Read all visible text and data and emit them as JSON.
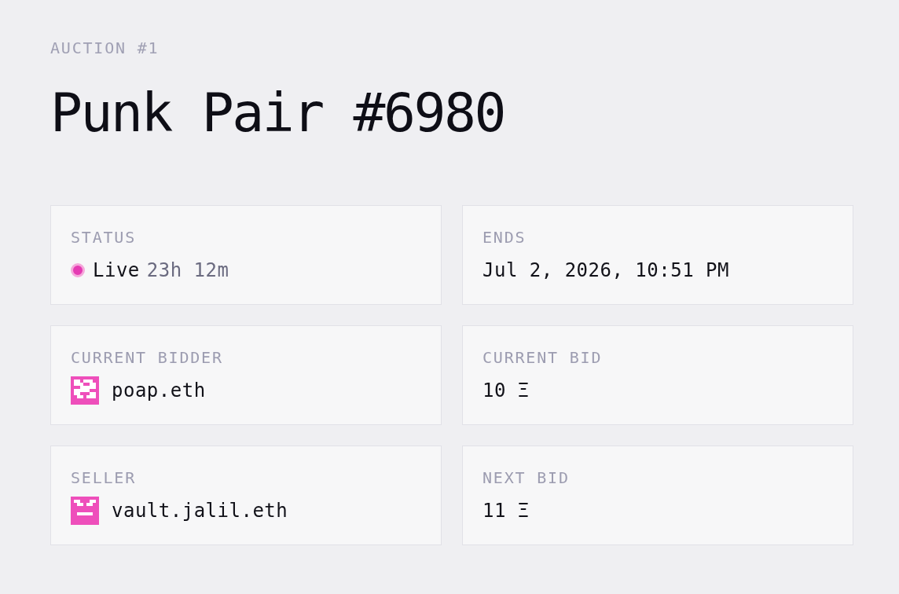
{
  "header": {
    "eyebrow": "AUCTION #1",
    "title": "Punk Pair #6980"
  },
  "cards": [
    {
      "kind": "status",
      "label": "STATUS",
      "status": "Live",
      "countdown": "23h 12m"
    },
    {
      "kind": "text",
      "label": "ENDS",
      "value": "Jul 2, 2026, 10:51 PM"
    },
    {
      "kind": "account",
      "label": "CURRENT BIDDER",
      "value": "poap.eth"
    },
    {
      "kind": "text",
      "label": "CURRENT BID",
      "value": "10 Ξ"
    },
    {
      "kind": "account",
      "label": "SELLER",
      "value": "vault.jalil.eth"
    },
    {
      "kind": "text",
      "label": "NEXT BID",
      "value": "11 Ξ"
    }
  ]
}
